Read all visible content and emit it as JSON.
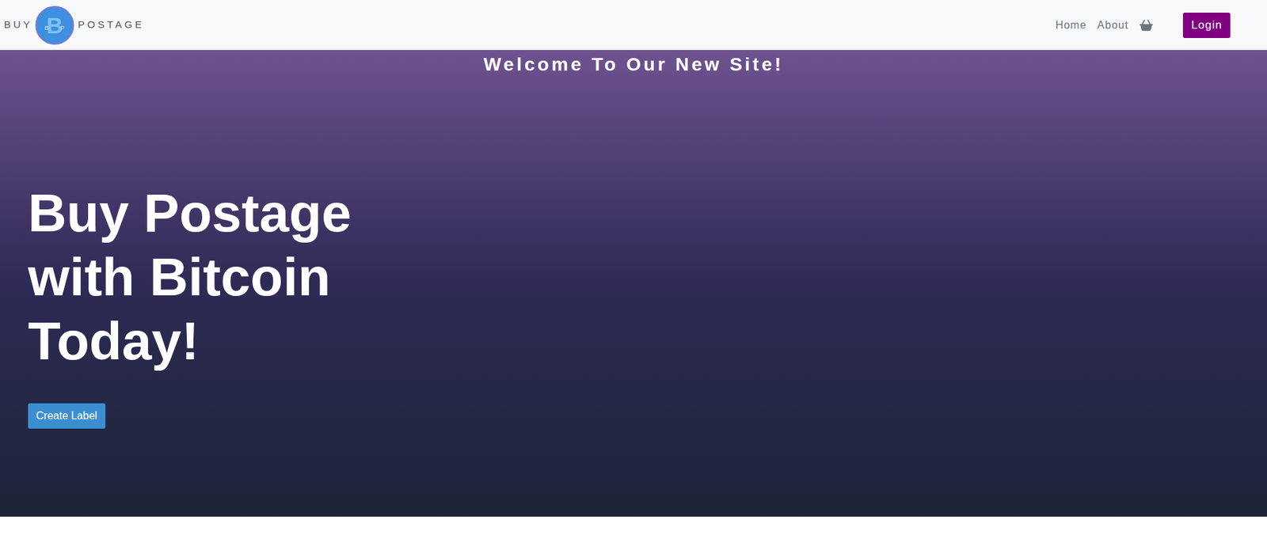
{
  "nav": {
    "logo": {
      "left": "BUY",
      "right": "POSTAGE",
      "mark": "B",
      "mark_letters": [
        "B",
        "P"
      ]
    },
    "links": [
      {
        "label": "Home"
      },
      {
        "label": "About"
      }
    ],
    "login": "Login"
  },
  "hero": {
    "welcome": "Welcome To Our New Site!",
    "heading": [
      "Buy Postage",
      "with Bitcoin",
      "Today!"
    ],
    "button": "Create Label"
  }
}
